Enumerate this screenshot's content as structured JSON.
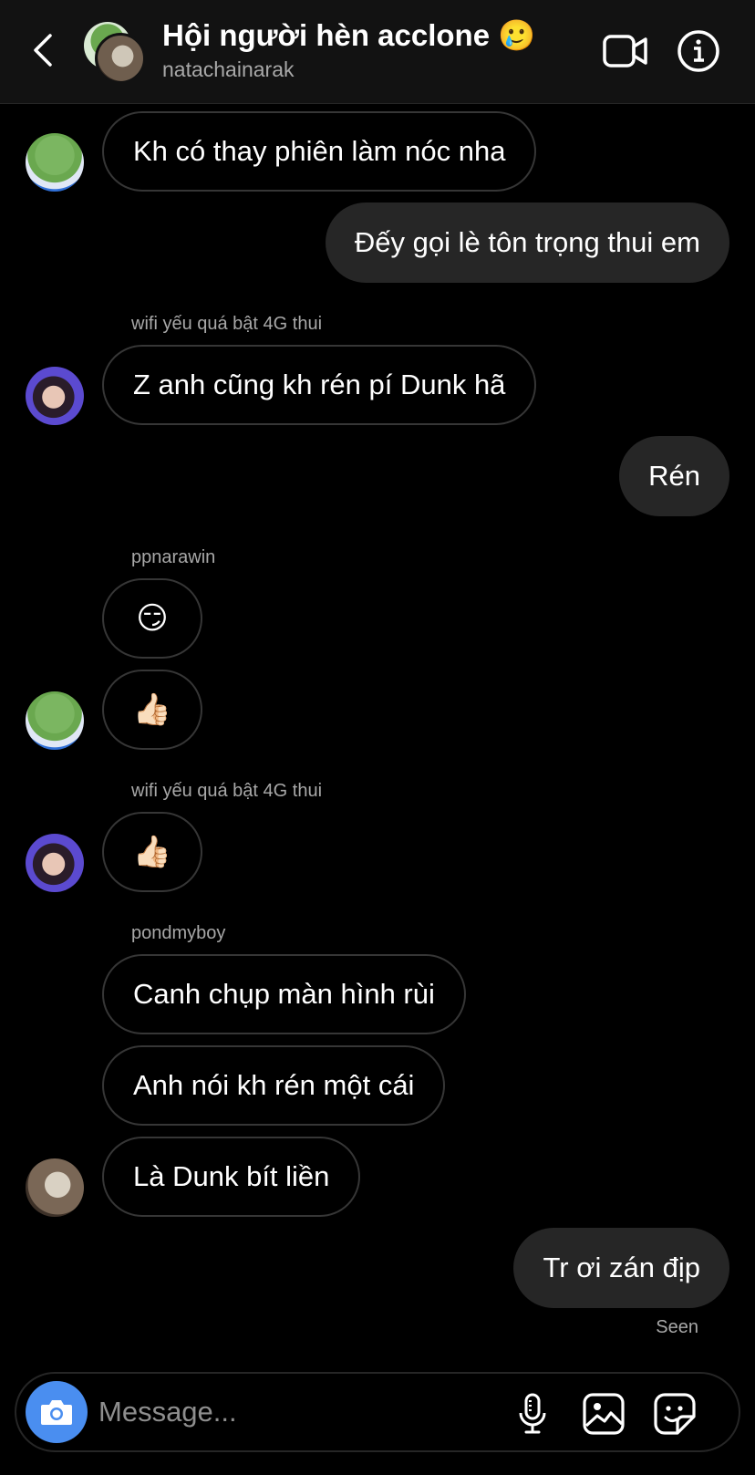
{
  "header": {
    "title": "Hội người hèn acclone 🥲",
    "subtitle": "natachainarak"
  },
  "messages": {
    "m1": "Kh có thay phiên làm nóc nha",
    "m2": "Đếy gọi lè tôn trọng thui em",
    "sender1": "wifi yếu quá bật 4G thui",
    "m3": "Z anh cũng kh rén pí Dunk hã",
    "m4": "Rén",
    "sender2": "ppnarawin",
    "m5": "😏",
    "m6": "👍🏻",
    "sender3": "wifi yếu quá bật 4G thui",
    "m7": "👍🏻",
    "sender4": "pondmyboy",
    "m8": "Canh chụp màn hình rùi",
    "m9": "Anh nói kh rén một cái",
    "m10": "Là Dunk bít liền",
    "m11": "Tr ơi zán địp",
    "seen": "Seen"
  },
  "composer": {
    "placeholder": "Message..."
  },
  "colors": {
    "background": "#000000",
    "outgoing_bubble": "#262626",
    "incoming_border": "#363636",
    "camera_button": "#4a8ef0",
    "secondary_text": "#a8a8a8"
  }
}
